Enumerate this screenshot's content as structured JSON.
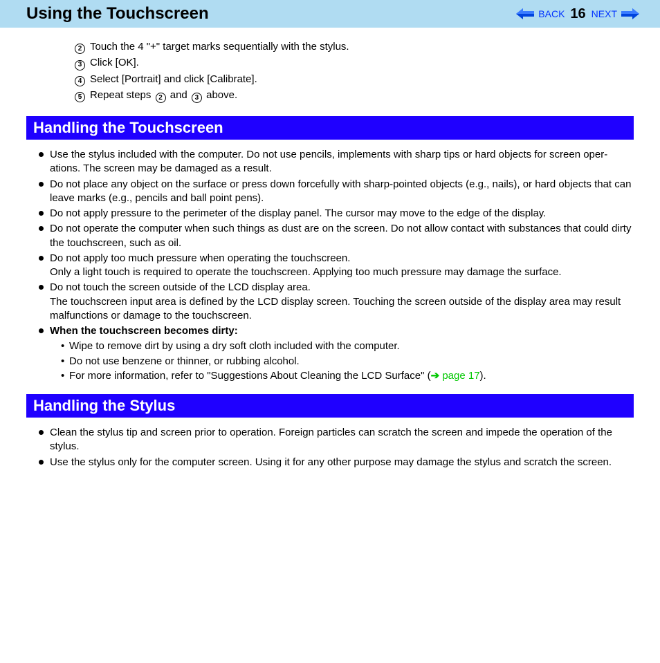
{
  "header": {
    "title": "Using the Touchscreen",
    "back": "BACK",
    "next": "NEXT",
    "page": "16"
  },
  "steps": {
    "s2_num": "2",
    "s2": "Touch the 4 \"+\" target marks sequentially with the stylus.",
    "s3_num": "3",
    "s3": "Click [OK].",
    "s4_num": "4",
    "s4": "Select [Portrait] and click [Calibrate].",
    "s5_num": "5",
    "s5_a": "Repeat steps ",
    "s5_b": " and ",
    "s5_c": " above.",
    "ref2": "2",
    "ref3": "3"
  },
  "section1": {
    "title": "Handling the Touchscreen",
    "b1": "Use the stylus included with the computer. Do not use pencils, implements with sharp tips or hard objects for screen oper-ations. The screen may be damaged as a result.",
    "b2": "Do not place any object on the surface or press down forcefully with sharp-pointed objects (e.g., nails), or hard objects that can leave marks (e.g., pencils and ball point pens).",
    "b3": "Do not apply pressure to the perimeter of the display panel. The cursor may move to the edge of the display.",
    "b4": "Do not operate the computer when such things as dust are on the screen. Do not allow contact with substances that could dirty the touchscreen, such as oil.",
    "b5a": "Do not apply too much pressure when operating the touchscreen.",
    "b5b": "Only a light touch is required to operate the touchscreen. Applying too much pressure may damage the surface.",
    "b6a": "Do not touch the screen outside of the LCD display area.",
    "b6b": "The touchscreen input area is defined by the LCD display screen. Touching the screen outside of the display area may result malfunctions or damage to the touchscreen.",
    "b7": "When the touchscreen becomes dirty:",
    "sub1": "Wipe to remove dirt by using a dry soft cloth included with the computer.",
    "sub2": "Do not use benzene or thinner, or rubbing alcohol.",
    "sub3a": "For more information, refer to \"Suggestions About Cleaning the LCD Surface\" (",
    "sub3link": " page 17",
    "sub3b": ")."
  },
  "section2": {
    "title": "Handling the Stylus",
    "b1": "Clean the stylus tip and screen prior to operation. Foreign particles can scratch the screen and impede the operation of the stylus.",
    "b2": "Use the stylus only for the computer screen. Using it for any other purpose may damage the stylus and scratch the screen."
  }
}
